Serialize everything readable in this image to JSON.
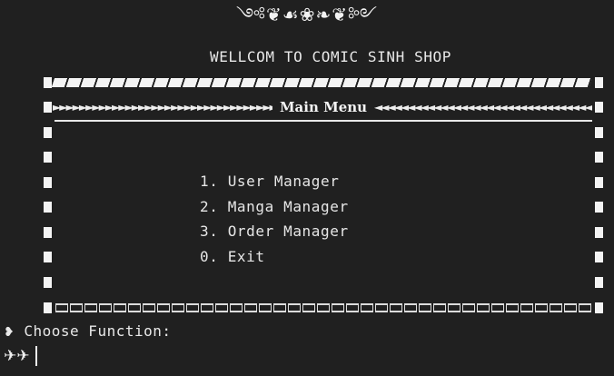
{
  "header": {
    "ornament": "༺❦☙❀❧❦༻",
    "welcome_text": "WELLCOM TO COMIC SINH SHOP"
  },
  "menu": {
    "title": "Main Menu",
    "arrows_left": "►►►►►►►►►►►►►►►►►►►►►►►►►►►►►►►►►►►►►►►",
    "arrows_right": "◄◄◄◄◄◄◄◄◄◄◄◄◄◄◄◄◄◄◄◄◄◄◄◄◄◄◄◄◄◄◄◄◄◄◄◄◄◄◄◄",
    "items": [
      {
        "label": "1. User Manager"
      },
      {
        "label": "2. Manga Manager"
      },
      {
        "label": "3. Order Manager"
      },
      {
        "label": "0. Exit"
      }
    ]
  },
  "prompt": {
    "icon": "❥",
    "text": "Choose Function:"
  },
  "input": {
    "marker": "✈✈",
    "value": ""
  }
}
